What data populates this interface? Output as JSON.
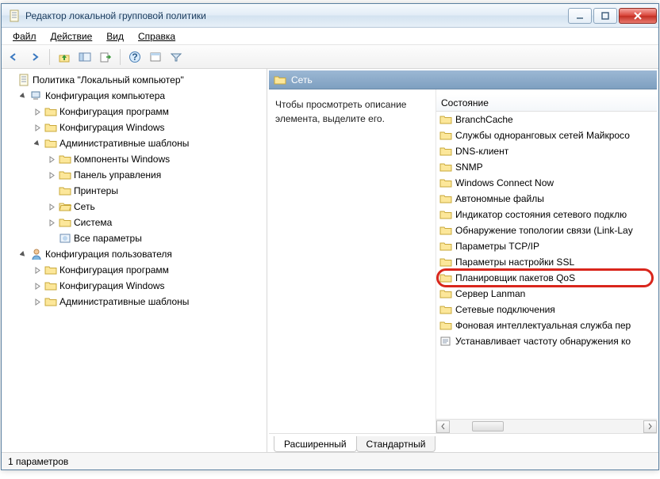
{
  "window": {
    "title": "Редактор локальной групповой политики"
  },
  "menu": {
    "file": "Файл",
    "action": "Действие",
    "view": "Вид",
    "help": "Справка"
  },
  "tree": {
    "root": "Политика \"Локальный компьютер\"",
    "comp": "Конфигурация компьютера",
    "comp_sw": "Конфигурация программ",
    "comp_win": "Конфигурация Windows",
    "comp_adm": "Административные шаблоны",
    "comp_adm_comp": "Компоненты Windows",
    "comp_adm_cp": "Панель управления",
    "comp_adm_prn": "Принтеры",
    "comp_adm_net": "Сеть",
    "comp_adm_sys": "Система",
    "comp_adm_all": "Все параметры",
    "user": "Конфигурация пользователя",
    "user_sw": "Конфигурация программ",
    "user_win": "Конфигурация Windows",
    "user_adm": "Административные шаблоны"
  },
  "right": {
    "category": "Сеть",
    "desc": "Чтобы просмотреть описание элемента, выделите его.",
    "col_state": "Состояние",
    "items": {
      "i0": "BranchCache",
      "i1": "Службы одноранговых сетей Майкросо",
      "i2": "DNS-клиент",
      "i3": "SNMP",
      "i4": "Windows Connect Now",
      "i5": "Автономные файлы",
      "i6": "Индикатор состояния сетевого подклю",
      "i7": "Обнаружение топологии связи (Link-Lay",
      "i8": "Параметры TCP/IP",
      "i9": "Параметры настройки SSL",
      "i10": "Планировщик пакетов QoS",
      "i11": "Сервер Lanman",
      "i12": "Сетевые подключения",
      "i13": "Фоновая интеллектуальная служба пер",
      "i14": "Устанавливает частоту обнаружения ко"
    },
    "tab_ext": "Расширенный",
    "tab_std": "Стандартный"
  },
  "status": {
    "text": "1 параметров"
  }
}
